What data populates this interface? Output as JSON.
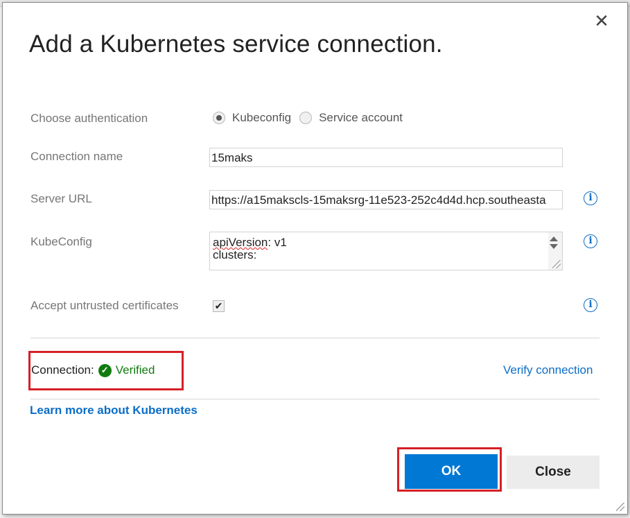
{
  "dialog": {
    "title": "Add a Kubernetes service connection.",
    "close_icon": "close-icon"
  },
  "auth": {
    "label": "Choose authentication",
    "options": [
      "Kubeconfig",
      "Service account"
    ],
    "selected": "Kubeconfig"
  },
  "connection_name": {
    "label": "Connection name",
    "value": "15maks"
  },
  "server_url": {
    "label": "Server URL",
    "value": "https://a15makscls-15maksrg-11e523-252c4d4d.hcp.southeasta"
  },
  "kubeconfig": {
    "label": "KubeConfig",
    "line1_key": "apiVersion",
    "line1_rest": ": v1",
    "line2": "clusters:"
  },
  "untrusted": {
    "label": "Accept untrusted certificates",
    "checked": true,
    "check_glyph": "✔"
  },
  "status": {
    "label": "Connection:",
    "icon": "check-circle-icon",
    "value": "Verified",
    "color": "#107c10"
  },
  "links": {
    "verify": "Verify connection",
    "learn_more": "Learn more about Kubernetes"
  },
  "buttons": {
    "ok": "OK",
    "close": "Close",
    "ok_color": "#0078d4"
  },
  "colors": {
    "highlight": "#d61f26",
    "link": "#0b6dc7"
  }
}
